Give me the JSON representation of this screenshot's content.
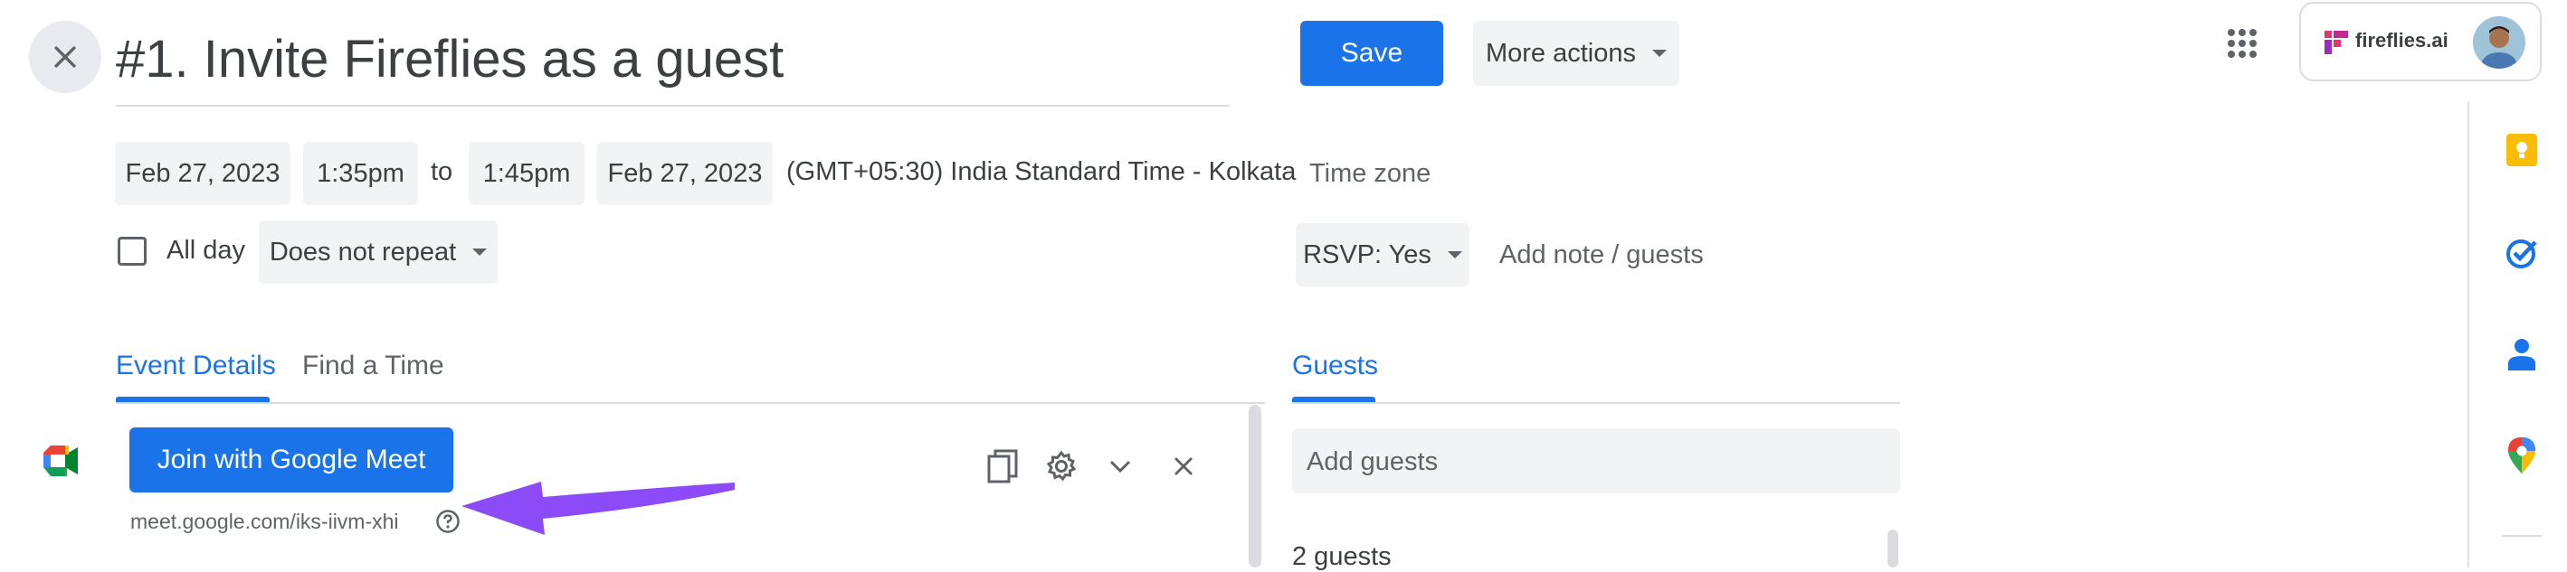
{
  "event": {
    "title": "#1. Invite Fireflies as a guest",
    "start_date": "Feb 27, 2023",
    "start_time": "1:35pm",
    "to_label": "to",
    "end_time": "1:45pm",
    "end_date": "Feb 27, 2023",
    "timezone_text": "(GMT+05:30) India Standard Time - Kolkata",
    "timezone_button": "Time zone",
    "all_day_label": "All day",
    "repeat_value": "Does not repeat"
  },
  "toolbar": {
    "save_label": "Save",
    "more_actions_label": "More actions"
  },
  "account": {
    "brand": "fireflies.ai"
  },
  "rsvp": {
    "value": "RSVP: Yes",
    "add_note_label": "Add note / guests"
  },
  "tabs": [
    {
      "label": "Event Details",
      "active": true
    },
    {
      "label": "Find a Time",
      "active": false
    }
  ],
  "meet": {
    "join_label": "Join with Google Meet",
    "link": "meet.google.com/iks-iivm-xhi"
  },
  "guests": {
    "tab_label": "Guests",
    "add_placeholder": "Add guests",
    "count_text": "2 guests"
  },
  "side_panel": {
    "icons": [
      "keep-icon",
      "tasks-icon",
      "contacts-icon",
      "maps-icon"
    ]
  },
  "colors": {
    "accent": "#1a73e8",
    "arrow": "#8b4cf7",
    "chip_bg": "#f1f3f4"
  }
}
